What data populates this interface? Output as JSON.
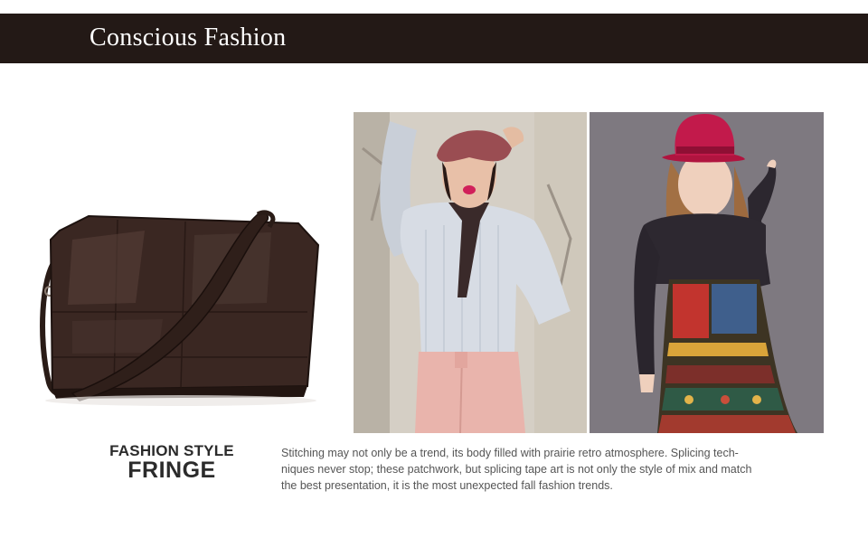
{
  "header": {
    "title": "Conscious Fashion",
    "bar_color": "#231916"
  },
  "images": [
    {
      "name": "leather-shoulder-bag"
    },
    {
      "name": "model-striped-shirt-beret"
    },
    {
      "name": "model-fedora-patchwork-dress"
    }
  ],
  "feature": {
    "heading_line1": "FASHION STYLE",
    "heading_line2": "FRINGE",
    "description_lines": [
      "Stitching may not only be a trend, its body filled with prairie retro atmosphere. Splicing tech-",
      "niques never stop; these patchwork, but splicing tape art is not only the style of mix and match",
      "the best presentation, it is the most unexpected fall fashion trends."
    ]
  }
}
